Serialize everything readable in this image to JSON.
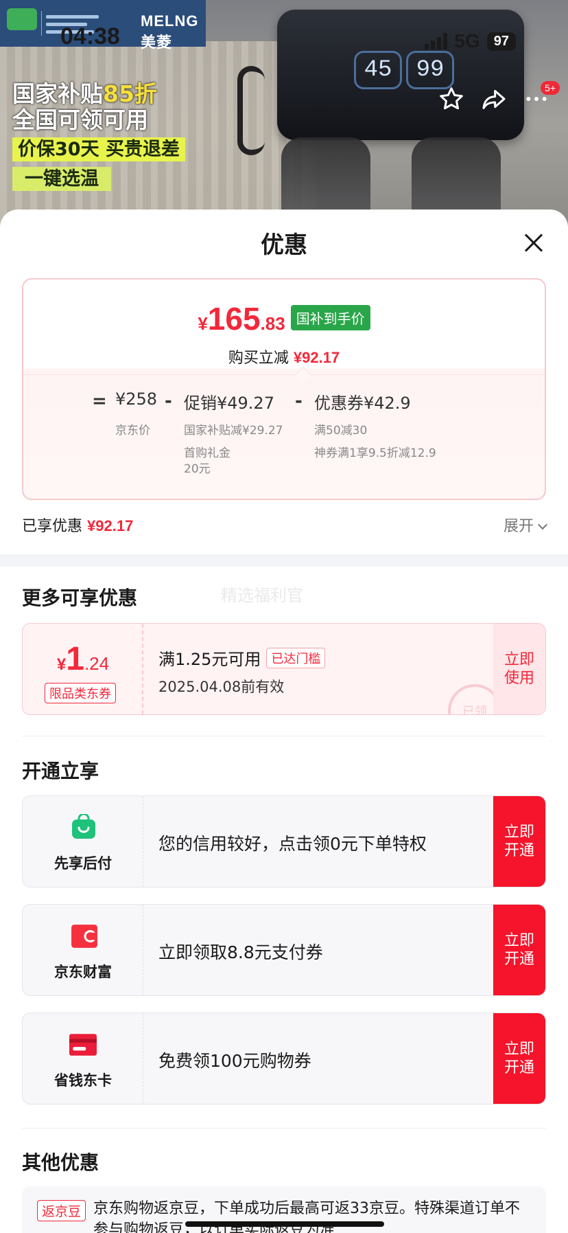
{
  "status_bar": {
    "time": "04:38",
    "network": "5G",
    "battery": "97"
  },
  "hero": {
    "brand_name": "MELNG美菱",
    "promo_line1_a": "国家补贴",
    "promo_line1_b": "85折",
    "promo_line2": "全国可领可用",
    "promo_line3": "价保30天 买贵退差",
    "promo_line4": "一键选温",
    "dial_left": "45",
    "dial_right": "99",
    "cart_badge": "5+"
  },
  "sheet": {
    "title": "优惠",
    "final_price": {
      "yen": "¥",
      "int": "165",
      "dec": ".83",
      "tag": "国补到手价"
    },
    "instant_off_label": "购买立减",
    "instant_off_value": "¥92.17",
    "breakdown": {
      "eq": "=",
      "base_value": "¥258",
      "base_label": "京东价",
      "minus1": "-",
      "promo_value": "促销¥49.27",
      "promo_note1": "国家补贴减¥29.27",
      "promo_note2a": "首购礼金",
      "promo_note2b": "20元",
      "minus2": "-",
      "coupon_value": "优惠券¥42.9",
      "coupon_note1": "满50减30",
      "coupon_note2": "神券满1享9.5折减12.9"
    },
    "enjoyed_label": "已享优惠",
    "enjoyed_value": "¥92.17",
    "expand_label": "展开"
  },
  "more": {
    "title": "更多可享优惠",
    "watermark": "精选福利官",
    "coupon": {
      "yen": "¥",
      "int": "1",
      "dec": ".24",
      "tag": "限品类东券",
      "condition": "满1.25元可用",
      "reached": "已达门槛",
      "valid": "2025.04.08前有效",
      "button": "立即使用",
      "stamp": "已领"
    }
  },
  "open": {
    "title": "开通立享",
    "items": [
      {
        "name": "先享后付",
        "text": "您的信用较好，点击领0元下单特权",
        "button": "立即开通",
        "icon": "shopping-bag-icon"
      },
      {
        "name": "京东财富",
        "text": "立即领取8.8元支付券",
        "button": "立即开通",
        "icon": "wallet-icon"
      },
      {
        "name": "省钱东卡",
        "text": "免费领100元购物券",
        "button": "立即开通",
        "icon": "card-icon"
      }
    ]
  },
  "other": {
    "title": "其他优惠",
    "tag": "返京豆",
    "text": "京东购物返京豆，下单成功后最高可返33京豆。特殊渠道订单不参与购物返豆，以订单实际返豆为准"
  },
  "colors": {
    "accent": "#f2283a",
    "button_red": "#f5142b",
    "green_tag": "#2aa64a"
  }
}
